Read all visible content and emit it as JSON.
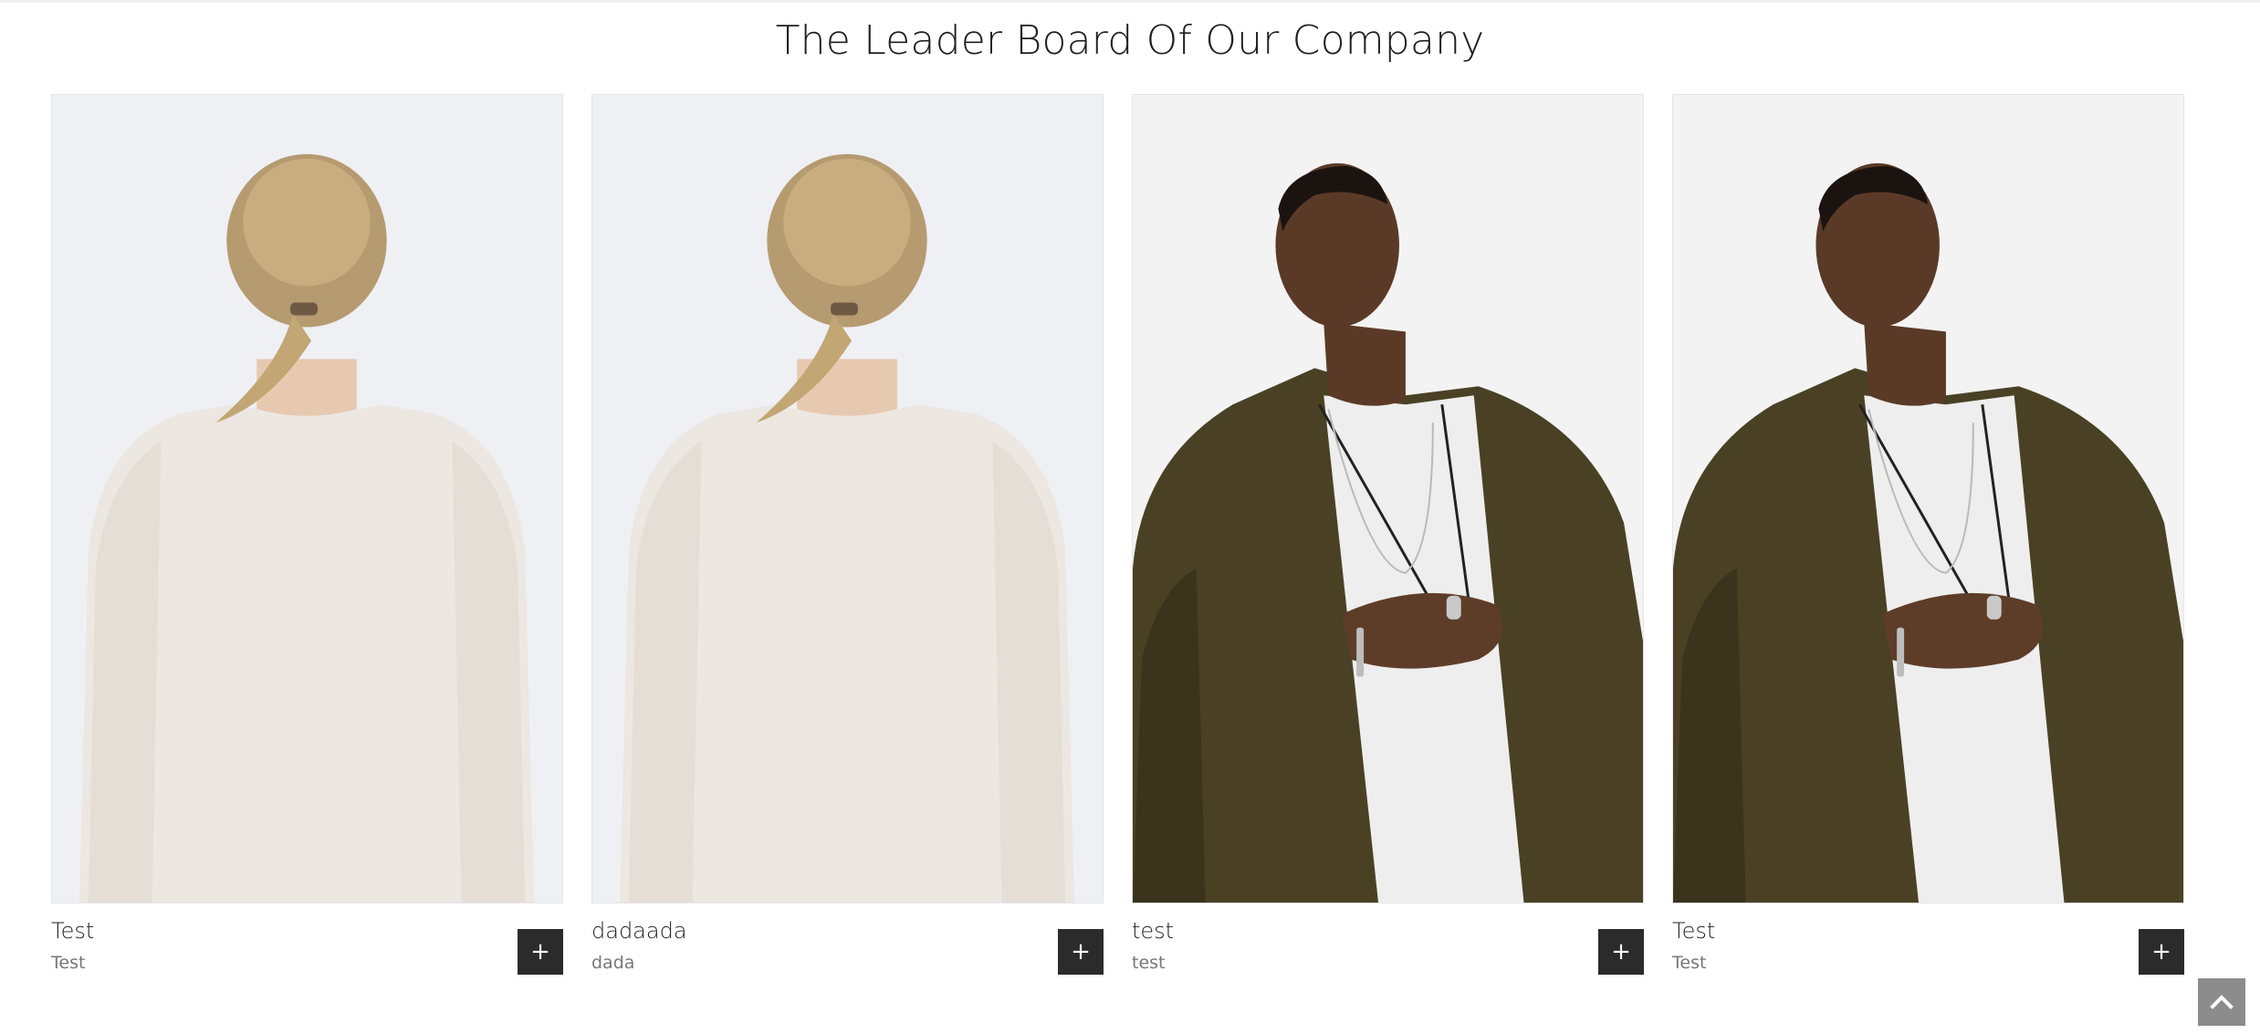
{
  "section": {
    "title": "The Leader Board Of Our Company"
  },
  "members": [
    {
      "name": "Test",
      "role": "Test",
      "photo": "woman-back-ponytail",
      "plus": "+"
    },
    {
      "name": "dadaada",
      "role": "dada",
      "photo": "woman-back-ponytail",
      "plus": "+"
    },
    {
      "name": "test",
      "role": "test",
      "photo": "man-jacket-necklace",
      "plus": "+"
    },
    {
      "name": "Test",
      "role": "Test",
      "photo": "man-jacket-necklace",
      "plus": "+"
    }
  ],
  "scroll_top": {
    "icon": "chevron-up-icon"
  },
  "colors": {
    "button_bg": "#2b2b2b",
    "scroll_bg": "#8c8c8c",
    "title": "#1f1f1f"
  }
}
